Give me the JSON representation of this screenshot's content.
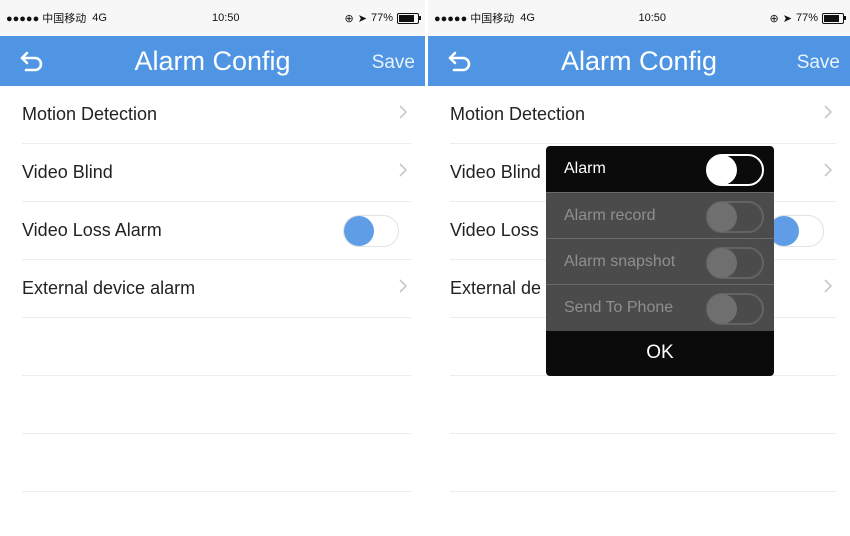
{
  "status_bar": {
    "signal": "●●●●● 中国移动",
    "network": "4G",
    "time": "10:50",
    "battery": "77%"
  },
  "nav": {
    "title": "Alarm Config",
    "save_label": "Save",
    "back_icon": "undo-arrow-icon"
  },
  "list": {
    "items": [
      {
        "label": "Motion Detection",
        "type": "chevron"
      },
      {
        "label": "Video Blind",
        "type": "chevron"
      },
      {
        "label": "Video Loss Alarm",
        "type": "toggle",
        "on": false
      },
      {
        "label": "External device alarm",
        "type": "chevron"
      }
    ],
    "right_truncated": [
      "Motion Detection",
      "Video Blind",
      "Video Loss",
      "External de"
    ]
  },
  "popup": {
    "items": [
      {
        "label": "Alarm",
        "on": false,
        "enabled": true
      },
      {
        "label": "Alarm record",
        "on": false,
        "enabled": false
      },
      {
        "label": "Alarm snapshot",
        "on": false,
        "enabled": false
      },
      {
        "label": "Send To Phone",
        "on": false,
        "enabled": false
      }
    ],
    "ok_label": "OK"
  },
  "colors": {
    "accent": "#4f95e3",
    "toggle_knob": "#5f9ee6",
    "popup_bg": "#0b0b0b",
    "popup_disabled": "#4b4b4b"
  }
}
